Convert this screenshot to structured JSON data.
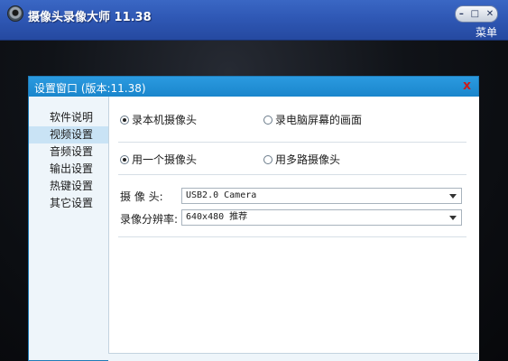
{
  "app": {
    "title": "摄像头录像大师 11.38",
    "menu_label": "菜单",
    "controls": {
      "minimize": "–",
      "maximize": "□",
      "close": "✕"
    }
  },
  "dialog": {
    "title": "设置窗口 (版本:11.38)",
    "close": "x",
    "sidebar": [
      {
        "label": "软件说明"
      },
      {
        "label": "视频设置"
      },
      {
        "label": "音频设置"
      },
      {
        "label": "输出设置"
      },
      {
        "label": "热键设置"
      },
      {
        "label": "其它设置"
      }
    ],
    "selected_sidebar": "视频设置",
    "source": {
      "option_local": "录本机摄像头",
      "option_screen": "录电脑屏幕的画面",
      "selected": "录本机摄像头"
    },
    "camera_count": {
      "option_single": "用一个摄像头",
      "option_multi": "用多路摄像头",
      "selected": "用一个摄像头"
    },
    "camera": {
      "label": "摄 像 头:",
      "value": "USB2.0 Camera"
    },
    "resolution": {
      "label": "录像分辨率:",
      "value": "640x480 推荐"
    }
  }
}
